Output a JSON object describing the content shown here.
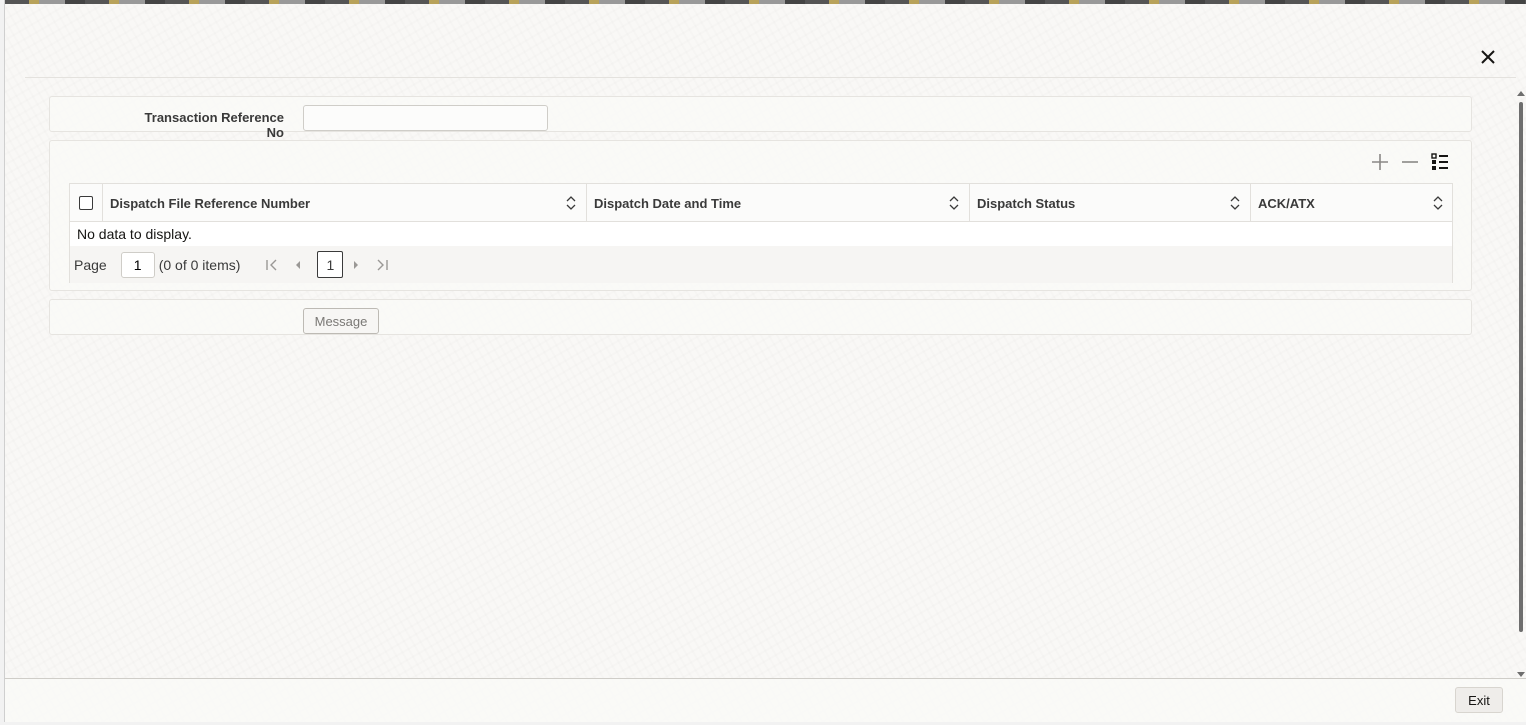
{
  "form": {
    "field_label": "Transaction Reference No",
    "field_value": ""
  },
  "grid": {
    "columns": [
      {
        "label": "Dispatch File Reference Number"
      },
      {
        "label": "Dispatch Date and Time"
      },
      {
        "label": "Dispatch Status"
      },
      {
        "label": "ACK/ATX"
      }
    ],
    "empty_text": "No data to display.",
    "pager": {
      "page_label": "Page",
      "page_value": "1",
      "items_text": "(0 of 0 items)",
      "current_page": "1"
    },
    "tools": [
      "add-row-icon",
      "delete-row-icon",
      "column-list-icon"
    ]
  },
  "actions": {
    "message_label": "Message",
    "exit_label": "Exit"
  },
  "colors": {
    "text": "#161513",
    "border": "#e2e0dc",
    "scrollbar": "#6e6e6e"
  }
}
